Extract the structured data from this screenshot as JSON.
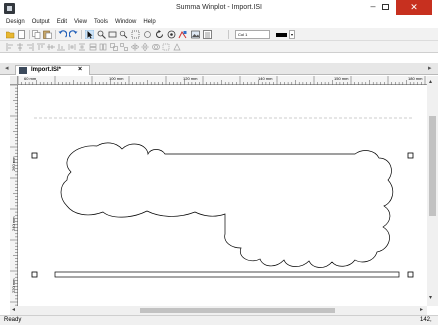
{
  "window": {
    "title": "Summa Winplot - Import.ISI",
    "minimize_glyph": "–",
    "close_glyph": "✕"
  },
  "menu": [
    "Design",
    "Output",
    "Edit",
    "View",
    "Tools",
    "Window",
    "Help"
  ],
  "toolbar": {
    "icons": [
      "open-icon",
      "new-icon",
      "copy-icon",
      "paste-icon",
      "undo-icon",
      "redo-icon",
      "select-pointer-icon",
      "zoom-icon",
      "rectangle-icon",
      "zoom-window-icon",
      "fit-page-icon",
      "circle-icon",
      "rotate-icon",
      "color-target-icon",
      "plot-icon",
      "image-icon",
      "layers-icon"
    ],
    "color_select": "Col 1",
    "color_swatch": "#000000",
    "dropdown_glyph": "▾"
  },
  "tabs": {
    "nav_left": "◂",
    "nav_right": "▸",
    "document_tab": "Import.ISI*",
    "close": "×"
  },
  "rulers": {
    "horizontal": [
      "60 mm",
      "100 mm",
      "120 mm",
      "140 mm",
      "150 mm",
      "180 mm"
    ],
    "vertical": [
      "260 mm",
      "240 mm",
      "220 mm"
    ]
  },
  "scrollbars": {
    "up": "▴",
    "down": "▾",
    "left": "◂",
    "right": "▸"
  },
  "status": {
    "text": "Ready",
    "coordinate": "142,"
  },
  "colors": {
    "close_button": "#c7301f",
    "toolbar_bg": "#f2f2f2",
    "selection_handle": "#000000"
  }
}
